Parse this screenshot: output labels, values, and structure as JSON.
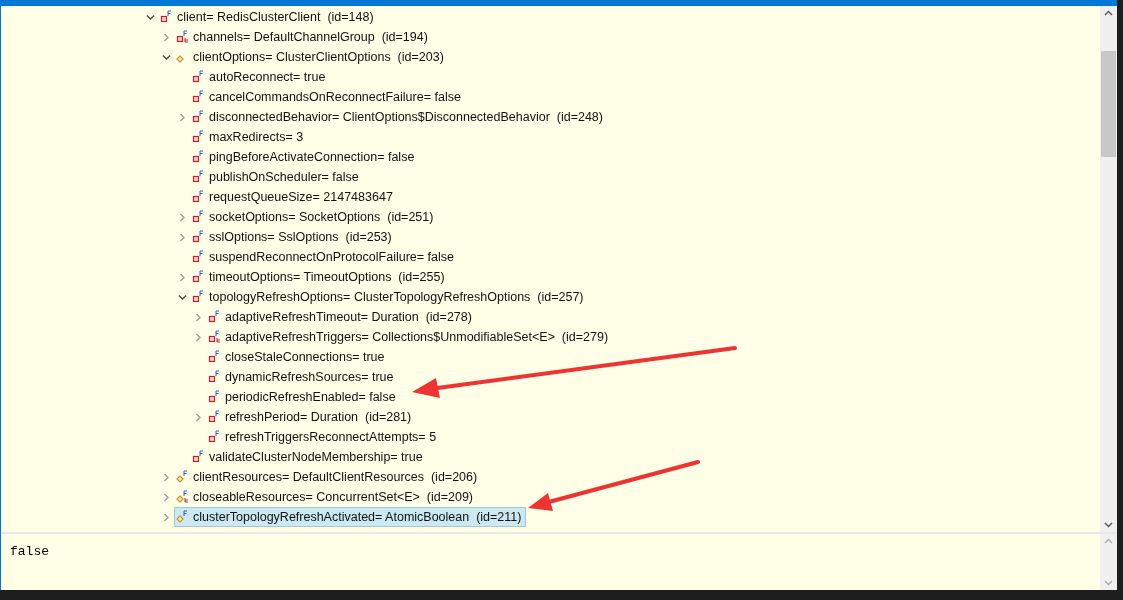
{
  "tree": [
    {
      "label": "client= RedisClusterClient  (id=148)",
      "kind": "private-final",
      "expanded": true,
      "selected": false,
      "children": [
        {
          "label": "channels= DefaultChannelGroup  (id=194)",
          "kind": "private-final-collection",
          "expanded": false,
          "selected": false
        },
        {
          "label": "clientOptions= ClusterClientOptions  (id=203)",
          "kind": "package",
          "expanded": true,
          "selected": false,
          "children": [
            {
              "label": "autoReconnect= true",
              "kind": "private-final",
              "selected": false
            },
            {
              "label": "cancelCommandsOnReconnectFailure= false",
              "kind": "private-final",
              "selected": false
            },
            {
              "label": "disconnectedBehavior= ClientOptions$DisconnectedBehavior  (id=248)",
              "kind": "private-final",
              "expanded": false,
              "selected": false
            },
            {
              "label": "maxRedirects= 3",
              "kind": "private-final",
              "selected": false
            },
            {
              "label": "pingBeforeActivateConnection= false",
              "kind": "private-final",
              "selected": false
            },
            {
              "label": "publishOnScheduler= false",
              "kind": "private-final",
              "selected": false
            },
            {
              "label": "requestQueueSize= 2147483647",
              "kind": "private-final",
              "selected": false
            },
            {
              "label": "socketOptions= SocketOptions  (id=251)",
              "kind": "private-final",
              "expanded": false,
              "selected": false
            },
            {
              "label": "sslOptions= SslOptions  (id=253)",
              "kind": "private-final",
              "expanded": false,
              "selected": false
            },
            {
              "label": "suspendReconnectOnProtocolFailure= false",
              "kind": "private-final",
              "selected": false
            },
            {
              "label": "timeoutOptions= TimeoutOptions  (id=255)",
              "kind": "private-final",
              "expanded": false,
              "selected": false
            },
            {
              "label": "topologyRefreshOptions= ClusterTopologyRefreshOptions  (id=257)",
              "kind": "private-final",
              "expanded": true,
              "selected": false,
              "children": [
                {
                  "label": "adaptiveRefreshTimeout= Duration  (id=278)",
                  "kind": "private-final",
                  "expanded": false,
                  "selected": false
                },
                {
                  "label": "adaptiveRefreshTriggers= Collections$UnmodifiableSet<E>  (id=279)",
                  "kind": "private-final-collection",
                  "expanded": false,
                  "selected": false
                },
                {
                  "label": "closeStaleConnections= true",
                  "kind": "private-final",
                  "selected": false
                },
                {
                  "label": "dynamicRefreshSources= true",
                  "kind": "private-final",
                  "selected": false
                },
                {
                  "label": "periodicRefreshEnabled= false",
                  "kind": "private-final",
                  "selected": false
                },
                {
                  "label": "refreshPeriod= Duration  (id=281)",
                  "kind": "private-final",
                  "expanded": false,
                  "selected": false
                },
                {
                  "label": "refreshTriggersReconnectAttempts= 5",
                  "kind": "private-final",
                  "selected": false
                }
              ]
            },
            {
              "label": "validateClusterNodeMembership= true",
              "kind": "private-final",
              "selected": false
            }
          ]
        },
        {
          "label": "clientResources= DefaultClientResources  (id=206)",
          "kind": "package-final",
          "expanded": false,
          "selected": false
        },
        {
          "label": "closeableResources= ConcurrentSet<E>  (id=209)",
          "kind": "package-final-collection",
          "expanded": false,
          "selected": false
        },
        {
          "label": "clusterTopologyRefreshActivated= AtomicBoolean  (id=211)",
          "kind": "package-final",
          "expanded": false,
          "selected": true
        }
      ]
    }
  ],
  "detail": {
    "value": "false"
  }
}
